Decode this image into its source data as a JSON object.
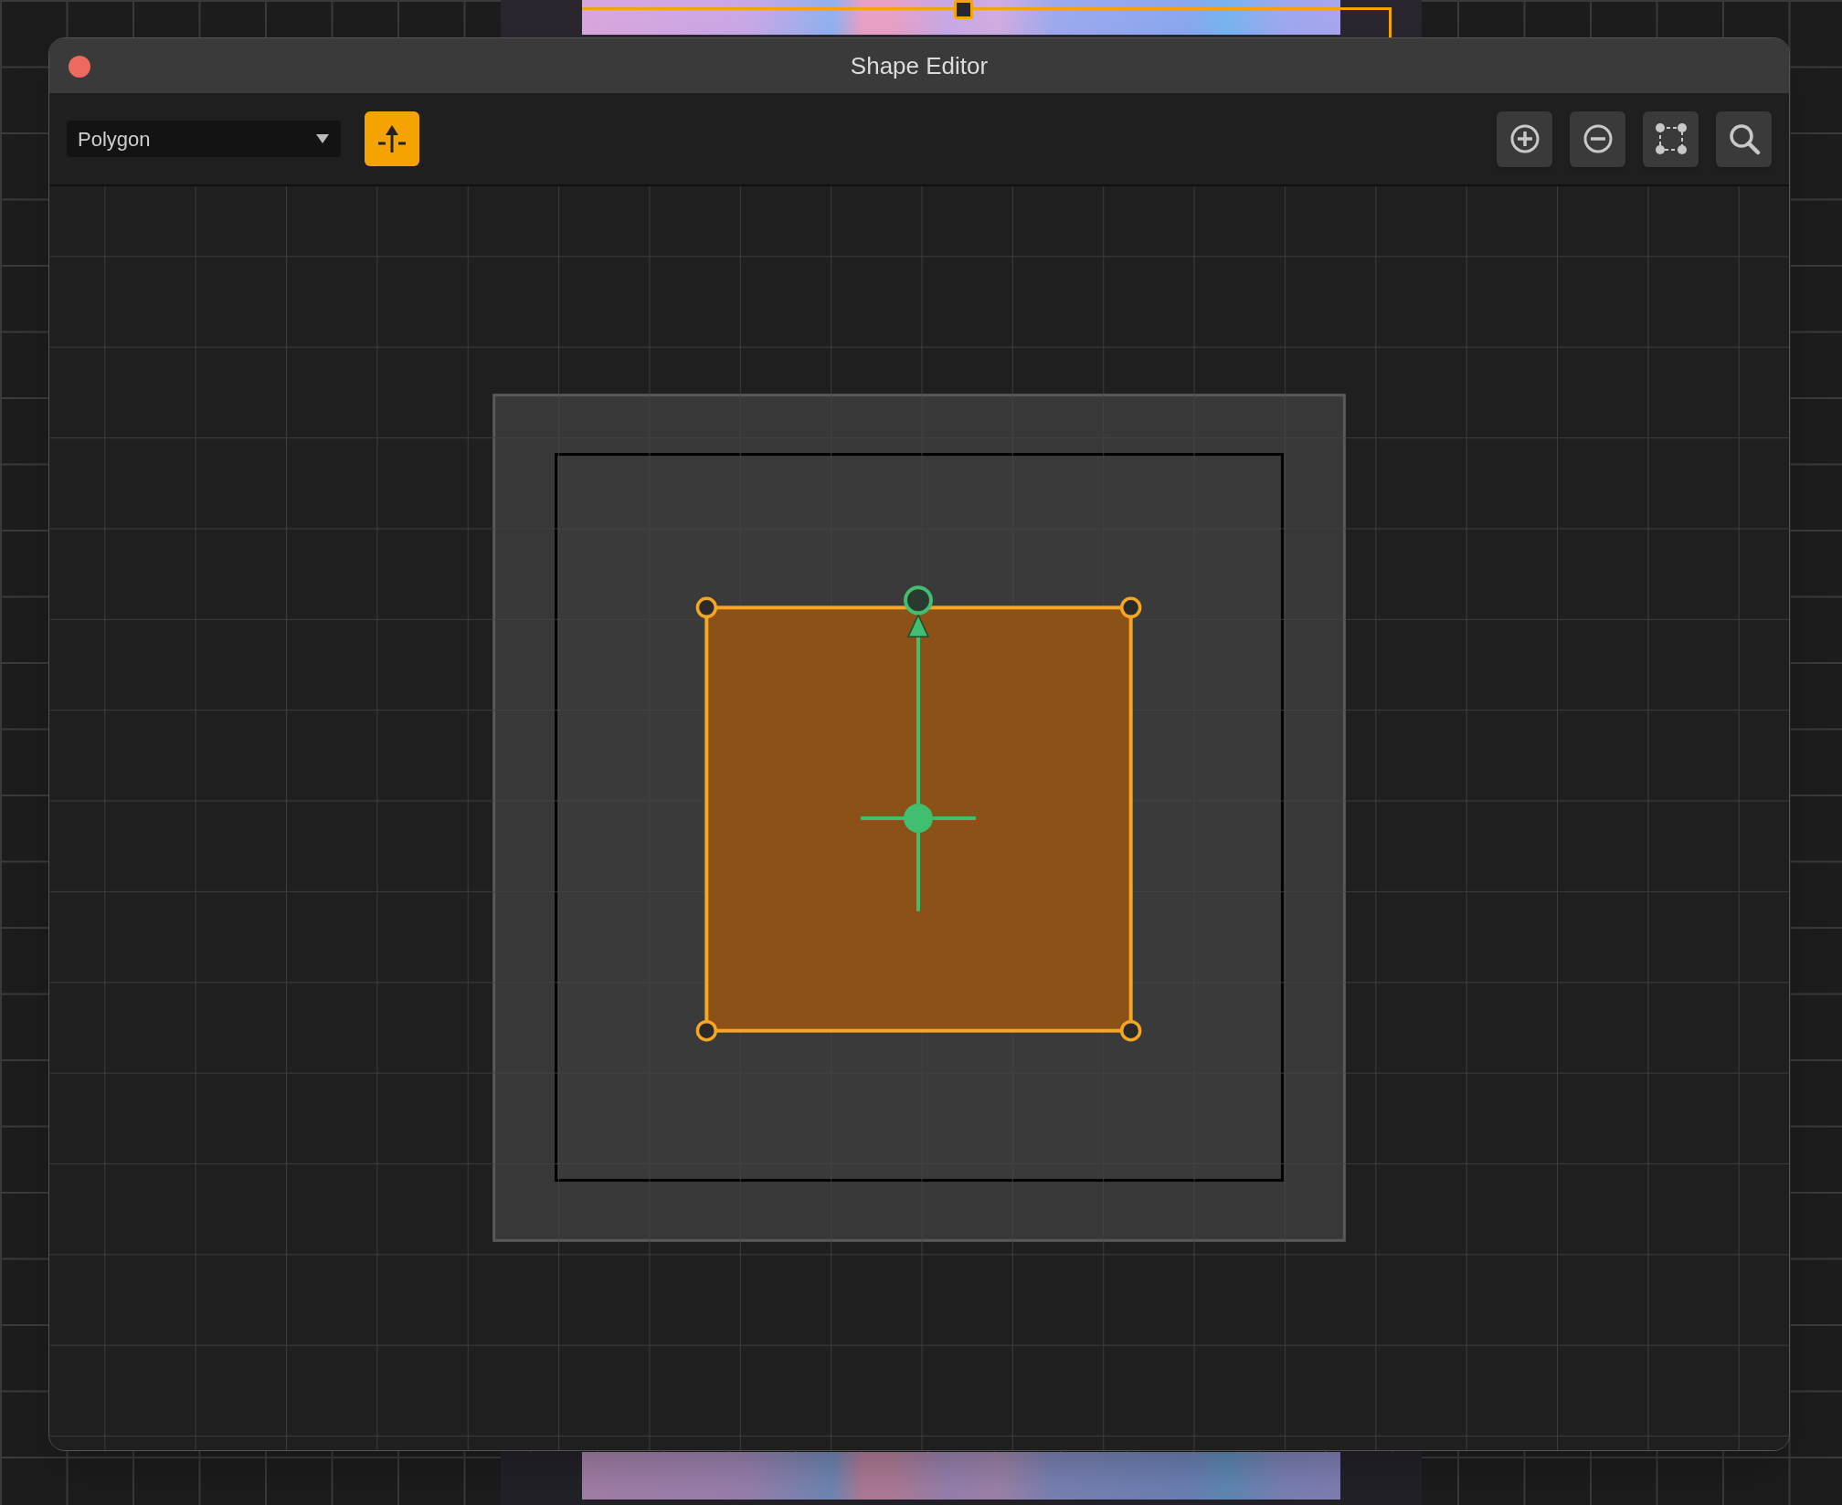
{
  "window": {
    "title": "Shape Editor"
  },
  "toolbar": {
    "shape_select": {
      "value": "Polygon"
    },
    "pivot_toggle": {
      "on": true
    }
  }
}
